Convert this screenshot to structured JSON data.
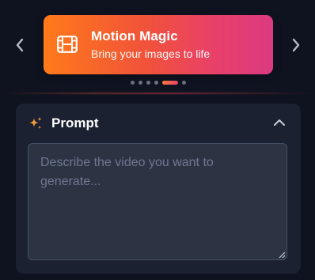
{
  "banner": {
    "title": "Motion Magic",
    "subtitle": "Bring your images to life",
    "icon": "film-icon",
    "gradient": [
      "#ff7a1a",
      "#e8406a",
      "#db3a82"
    ]
  },
  "carousel": {
    "prev_icon": "chevron-left-icon",
    "next_icon": "chevron-right-icon",
    "slide_count": 6,
    "active_slide": 5
  },
  "prompt_panel": {
    "title": "Prompt",
    "icon": "sparkle-icon",
    "collapse_icon": "chevron-up-icon",
    "accent": "#f29a3a",
    "input": {
      "value": "",
      "placeholder": "Describe the video you want to generate..."
    }
  },
  "colors": {
    "background": "#0f1320",
    "panel": "#1b2130",
    "input_background": "#2c3444"
  }
}
